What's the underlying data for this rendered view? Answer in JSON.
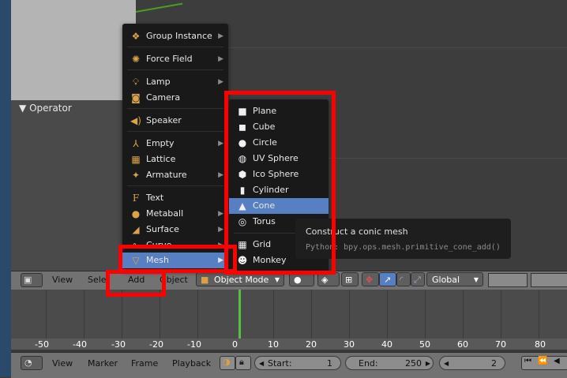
{
  "viewport": {
    "operator_title": "Operator"
  },
  "add_menu": {
    "items": [
      {
        "label": "Group Instance",
        "icon": "group-instance-icon",
        "has_sub": true
      },
      {
        "label": "Force Field",
        "icon": "force-field-icon",
        "has_sub": true
      },
      {
        "label": "Lamp",
        "icon": "lamp-icon",
        "has_sub": true
      },
      {
        "label": "Camera",
        "icon": "camera-icon",
        "has_sub": false
      },
      {
        "label": "Speaker",
        "icon": "speaker-icon",
        "has_sub": false
      },
      {
        "label": "Empty",
        "icon": "empty-icon",
        "has_sub": true
      },
      {
        "label": "Lattice",
        "icon": "lattice-icon",
        "has_sub": false
      },
      {
        "label": "Armature",
        "icon": "armature-icon",
        "has_sub": true
      },
      {
        "label": "Text",
        "icon": "text-icon",
        "has_sub": false
      },
      {
        "label": "Metaball",
        "icon": "metaball-icon",
        "has_sub": true
      },
      {
        "label": "Surface",
        "icon": "surface-icon",
        "has_sub": true
      },
      {
        "label": "Curve",
        "icon": "curve-icon",
        "has_sub": true
      },
      {
        "label": "Mesh",
        "icon": "mesh-icon",
        "has_sub": true
      }
    ]
  },
  "mesh_menu": {
    "items": [
      {
        "label": "Plane",
        "icon": "plane-icon"
      },
      {
        "label": "Cube",
        "icon": "cube-icon"
      },
      {
        "label": "Circle",
        "icon": "circle-icon"
      },
      {
        "label": "UV Sphere",
        "icon": "uv-sphere-icon"
      },
      {
        "label": "Ico Sphere",
        "icon": "ico-sphere-icon"
      },
      {
        "label": "Cylinder",
        "icon": "cylinder-icon"
      },
      {
        "label": "Cone",
        "icon": "cone-icon"
      },
      {
        "label": "Torus",
        "icon": "torus-icon"
      },
      {
        "label": "Grid",
        "icon": "grid-icon"
      },
      {
        "label": "Monkey",
        "icon": "monkey-icon"
      }
    ]
  },
  "tooltip": {
    "title": "Construct a conic mesh",
    "python": "Python: bpy.ops.mesh.primitive_cone_add()"
  },
  "header": {
    "view": "View",
    "select": "Select",
    "add": "Add",
    "object": "Object",
    "mode": "Object Mode",
    "orientation": "Global"
  },
  "timeline": {
    "ruler": [
      "-50",
      "-40",
      "-30",
      "-20",
      "-10",
      "0",
      "10",
      "20",
      "30",
      "40",
      "50",
      "60",
      "70",
      "80"
    ]
  },
  "bottom": {
    "view": "View",
    "marker": "Marker",
    "frame": "Frame",
    "playback": "Playback",
    "start_label": "Start:",
    "start_value": "1",
    "end_label": "End:",
    "end_value": "250",
    "current_frame": "2"
  },
  "colors": {
    "highlight": "#5680c2",
    "annotation": "#ff0000",
    "playhead": "#52c43b"
  }
}
